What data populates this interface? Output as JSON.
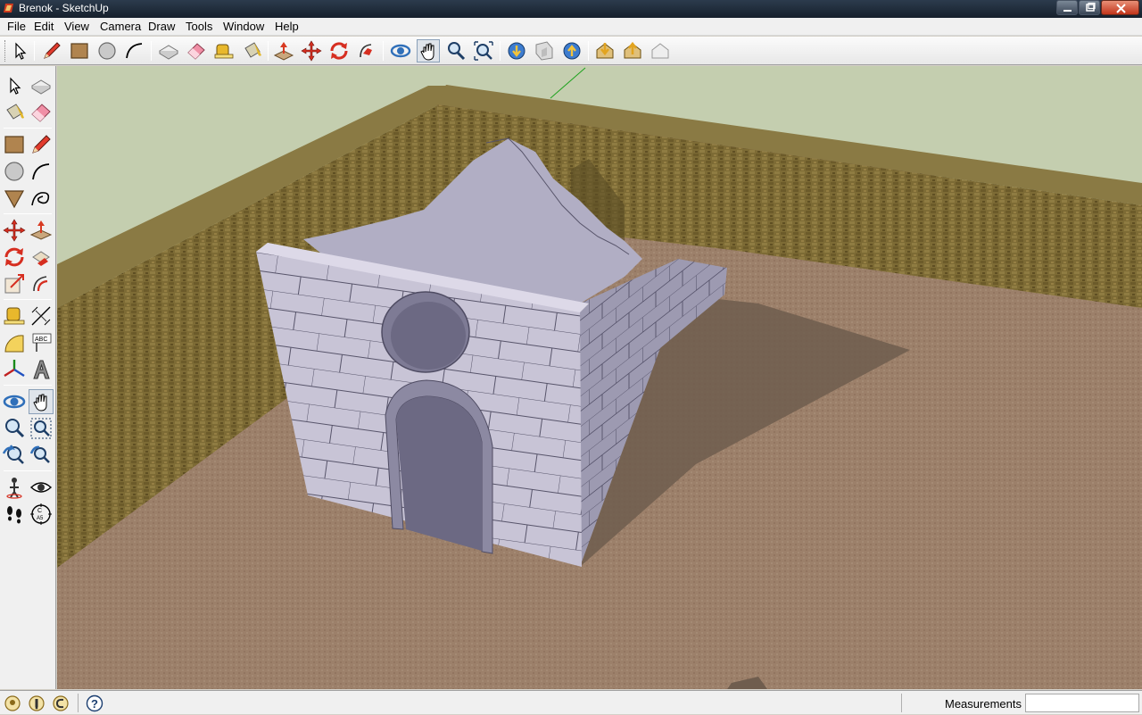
{
  "window": {
    "title": "Brenok - SketchUp",
    "controls": [
      "minimize-icon",
      "maximize-icon",
      "close-icon"
    ]
  },
  "menu": {
    "items": [
      "File",
      "Edit",
      "View",
      "Camera",
      "Draw",
      "Tools",
      "Window",
      "Help"
    ]
  },
  "toolbar_top": {
    "tools": [
      "select",
      "pencil",
      "rectangle",
      "circle",
      "arc",
      "make-component",
      "eraser",
      "tape-measure",
      "paint-bucket",
      "push-pull",
      "move",
      "rotate",
      "follow-me",
      "orbit",
      "pan",
      "zoom",
      "zoom-extents",
      "get-models",
      "share-model",
      "share-component",
      "get-photo-texture",
      "place-model",
      "get-current-view"
    ]
  },
  "toolbar_left": {
    "tools": [
      "select",
      "make-component",
      "paint-bucket",
      "eraser",
      "rectangle",
      "line",
      "circle",
      "arc",
      "polygon",
      "freehand",
      "move",
      "push-pull",
      "rotate",
      "follow-me",
      "scale",
      "offset",
      "tape-measure",
      "dimension",
      "protractor",
      "text",
      "axes",
      "3d-text",
      "orbit",
      "pan",
      "zoom",
      "zoom-window",
      "previous",
      "zoom-extents",
      "position-camera",
      "look-around",
      "walk",
      "section-plane"
    ]
  },
  "status": {
    "icons": [
      "geo-location-icon",
      "credits-icon",
      "login-icon",
      "help-icon"
    ],
    "measurements_label": "Measurements",
    "measurements_value": ""
  },
  "colors": {
    "sky": "#c5cfb0",
    "ground": "#9b7f69",
    "brick_wall": "#7a6a33",
    "building_face": "#c7c3d4",
    "building_side": "#9e9bb1",
    "shadow": "#6f5e4f",
    "title_bar": "#1f2b39"
  }
}
